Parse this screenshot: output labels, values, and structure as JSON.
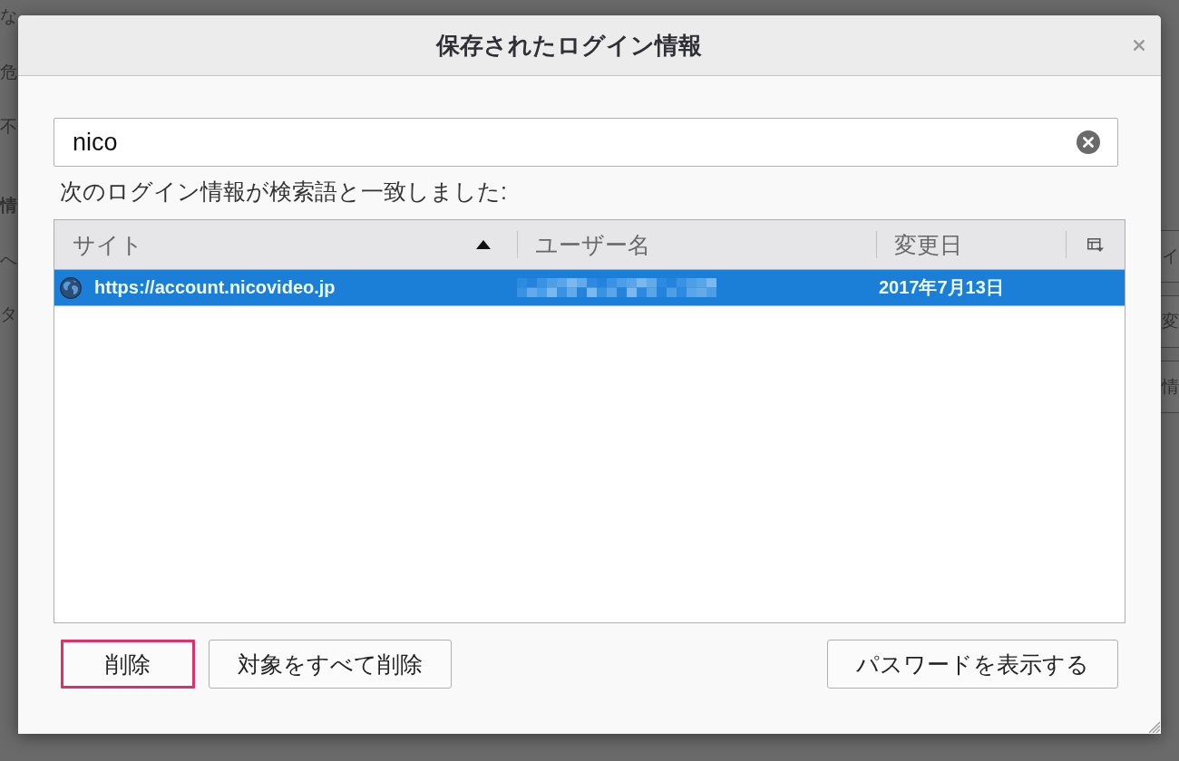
{
  "background_page": {
    "top_line": "な",
    "left_fragments": [
      {
        "text": "危",
        "bold": false
      },
      {
        "text": "不",
        "bold": false
      },
      {
        "text": "情",
        "bold": true
      },
      {
        "text": "へ",
        "bold": false
      },
      {
        "text": "タ",
        "bold": false
      }
    ],
    "right_buttons": [
      "イ",
      "変",
      "情"
    ]
  },
  "dialog": {
    "title": "保存されたログイン情報",
    "search": {
      "value": "nico"
    },
    "result_label": "次のログイン情報が検索語と一致しました:",
    "table": {
      "columns": [
        {
          "label": "サイト",
          "sorted": true
        },
        {
          "label": "ユーザー名",
          "sorted": false
        },
        {
          "label": "変更日",
          "sorted": false
        }
      ],
      "rows": [
        {
          "site": "https://account.nicovideo.jp",
          "username_redacted": true,
          "changed": "2017年7月13日",
          "selected": true
        }
      ]
    },
    "buttons_left": [
      {
        "label": "削除",
        "highlighted": true
      },
      {
        "label": "対象をすべて削除",
        "highlighted": false
      }
    ],
    "buttons_right": [
      {
        "label": "パスワードを表示する",
        "highlighted": false
      }
    ]
  }
}
